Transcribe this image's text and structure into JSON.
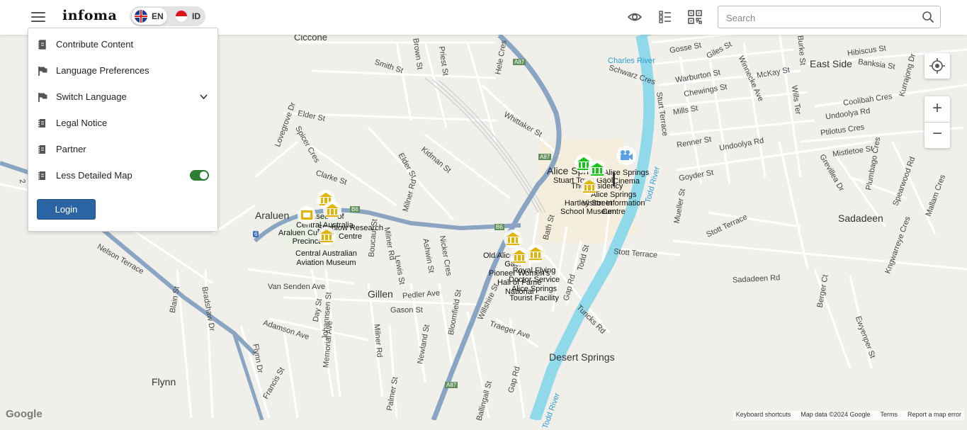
{
  "header": {
    "logo_text": "infoma",
    "languages": [
      {
        "code": "EN",
        "active": true
      },
      {
        "code": "ID",
        "active": false
      }
    ],
    "icons": [
      "eye-icon",
      "list-icon",
      "qr-code-icon"
    ],
    "search": {
      "placeholder": "Search",
      "value": ""
    }
  },
  "menu": {
    "items": [
      {
        "label": "Contribute Content",
        "icon": "document-icon"
      },
      {
        "label": "Language Preferences",
        "icon": "flag-icon"
      },
      {
        "label": "Switch Language",
        "icon": "flag-icon",
        "expandable": true
      },
      {
        "label": "Legal Notice",
        "icon": "document-icon"
      },
      {
        "label": "Partner",
        "icon": "document-icon"
      },
      {
        "label": "Less Detailed Map",
        "icon": "document-icon",
        "toggle": true
      }
    ],
    "login_label": "Login"
  },
  "map": {
    "areas": {
      "ciccone": "Ciccone",
      "east_side": "East Side",
      "araluen": "Araluen",
      "gillen": "Gillen",
      "sadadeen": "Sadadeen",
      "desert_springs": "Desert Springs",
      "flynn": "Flynn",
      "alice_springs": "Alice Springs"
    },
    "streets": {
      "smith_st": "Smith St",
      "brown_st": "Brown St",
      "priest_st": "Priest St",
      "hele_cres": "Hele Cres",
      "gosse_st": "Gosse St",
      "giles_st": "Giles St",
      "burke_st": "Burke St",
      "hibiscus_st": "Hibiscus St",
      "banksia_st": "Banksia St",
      "kurrajong_dr": "Kurrajong Dr",
      "mckay_st": "McKay St",
      "wills_ter": "Wills Ter",
      "winnecke_ave": "Winnecke Ave",
      "warburton_st": "Warburton St",
      "schwarz_cres": "Schwarz Cres",
      "charles_river": "Charles River",
      "chewings_st": "Chewings St",
      "mills_st": "Mills St",
      "sturt_terrace": "Sturt Terrace",
      "coolibah_cres": "Coolibah Cres",
      "undoolya_rd": "Undoolya Rd",
      "ptilotus_cres": "Ptilotus Cres",
      "renner_st": "Renner St",
      "mistletoe_st": "Mistletoe St",
      "plumbago_cres": "Plumbago Cres",
      "grevillea_dr": "Grevillea Dr",
      "spearwood_rd": "Spearwood Rd",
      "mallam_cres": "Mallam Cres",
      "goyder_st": "Goyder St",
      "mueller_st": "Mueller St",
      "stott_terrace": "Stott Terrace",
      "todd_river": "Todd River",
      "sadadeen_rd": "Sadadeen Rd",
      "kngwarreye_cres": "Kngwarreye Cres",
      "berger_ct": "Berger Ct",
      "ewyenper_st": "Ewyenper St",
      "elder_st": "Elder St",
      "lovegrove_dr": "Lovegrove Dr",
      "spicer_cres": "Spicer Cres",
      "kidman_st": "Kidman St",
      "whittaker_st": "Whittaker St",
      "clarke_st": "Clarke St",
      "milner_rd": "Milner Rd",
      "boucaut_st": "Boucaut St",
      "nicker_cres": "Nicker Cres",
      "lewis_st": "Lewis St",
      "ashwin_st": "Ashwin St",
      "bath_st": "Bath St",
      "gap_rd": "Gap Rd",
      "todd_st": "Todd St",
      "nelson_terrace": "Nelson Terrace",
      "van_senden_ave": "Van Senden Ave",
      "pedler_ave": "Pedler Ave",
      "gason_st": "Gason St",
      "blain_st": "Blain St",
      "bradshaw_dr": "Bradshaw Dr",
      "day_st": "Day St",
      "johannsen_st": "Johannsen St",
      "adamson_ave": "Adamson Ave",
      "memorial_ave": "Memorial Ave",
      "bloomfield_st": "Bloomfield St",
      "traeger_ave": "Traeger Ave",
      "tuncks_rd": "Tuncks Rd",
      "newland_st": "Newland St",
      "flynn_dr": "Flynn Dr",
      "francis_st": "Francis St",
      "palmer_st": "Palmer St",
      "ballingall_st": "Ballingall St",
      "willshire_st": "Willshire St",
      "a87": "A87",
      "b6": "B6",
      "r6": "6",
      "r2": "2"
    },
    "pois": [
      {
        "lines": [
          "Stuart Town",
          "Gaol"
        ],
        "icon": "museum-icon",
        "color": "#19c219"
      },
      {
        "lines": [
          "The Residency"
        ],
        "icon": "museum-icon",
        "color": "#19c219"
      },
      {
        "lines": [
          "Alice Springs",
          "Cinema"
        ],
        "icon": "camera-icon",
        "color": "#5aa0e6"
      },
      {
        "lines": [
          "Alice Springs",
          "Visitor Information",
          "Centre"
        ],
        "icon": "info-icon",
        "color": "#333333"
      },
      {
        "lines": [
          "Hartley Street",
          "School Museum"
        ],
        "icon": "museum-icon",
        "color": "#e2b400"
      },
      {
        "lines": [
          "Museum of",
          "Central Australia"
        ],
        "icon": "museum-icon",
        "color": "#e2b400"
      },
      {
        "lines": [
          "Strehlow Research",
          "Centre"
        ],
        "icon": "museum-icon",
        "color": "#e2b400"
      },
      {
        "lines": [
          "Araluen Cultural",
          "Precinct"
        ],
        "icon": "gallery-icon",
        "color": "#e2b400"
      },
      {
        "lines": [
          "Central Australian",
          "Aviation Museum"
        ],
        "icon": "museum-icon",
        "color": "#e2b400"
      },
      {
        "lines": [
          "Old Alice Springs",
          "Gaol"
        ],
        "icon": "museum-icon",
        "color": "#e2b400"
      },
      {
        "lines": [
          "Royal Flying",
          "Doctor Service",
          "Alice Springs",
          "Tourist Facility"
        ],
        "icon": "museum-icon",
        "color": "#e2b400"
      },
      {
        "lines": [
          "Pioneer Women's",
          "Hall of Fame",
          "National"
        ],
        "icon": "museum-icon",
        "color": "#e2b400"
      }
    ]
  },
  "controls": {
    "zoom_in": "+",
    "zoom_out": "−"
  },
  "attribution": {
    "google": "Google",
    "shortcuts": "Keyboard shortcuts",
    "map_data": "Map data ©2024 Google",
    "terms": "Terms",
    "report": "Report a map error"
  },
  "colors": {
    "accent": "#2a64a3",
    "toggle_on": "#2e7d32",
    "river": "#8fd9ea",
    "highway": "#8aa4c4",
    "land": "#f1efea"
  }
}
